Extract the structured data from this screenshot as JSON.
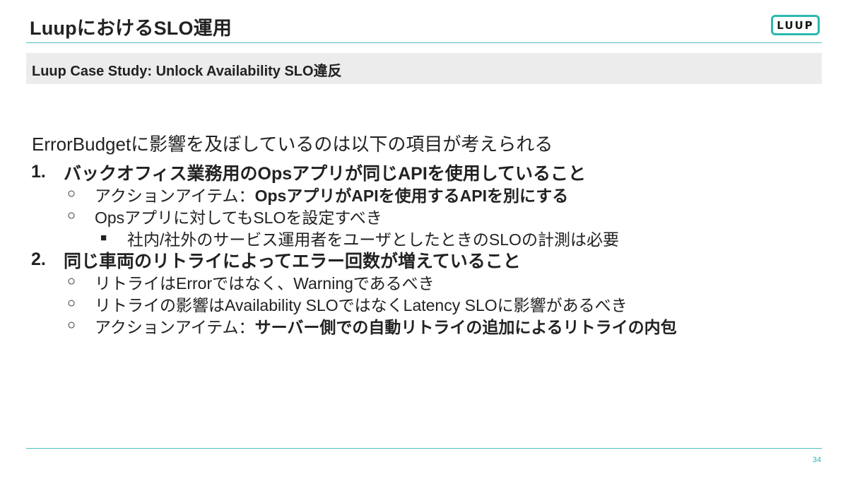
{
  "header": {
    "title": "LuupにおけるSLO運用",
    "logo_text": "LUUP",
    "subtitle": "Luup Case Study: Unlock Availability SLO違反"
  },
  "body": {
    "intro": "ErrorBudgetに影響を及ぼしているのは以下の項目が考えられる",
    "items": [
      {
        "number": "1.",
        "text": "バックオフィス業務用のOpsアプリが同じAPIを使用していること",
        "subitems": [
          {
            "bullet": "○",
            "prefix": "アクションアイテム：",
            "bold": "OpsアプリがAPIを使用するAPIを別にする"
          },
          {
            "bullet": "○",
            "text": "Opsアプリに対してもSLOを設定すべき",
            "subitems": [
              {
                "bullet": "■",
                "text": "社内/社外のサービス運用者をユーザとしたときのSLOの計測は必要"
              }
            ]
          }
        ]
      },
      {
        "number": "2.",
        "text": "同じ車両のリトライによってエラー回数が増えていること",
        "subitems": [
          {
            "bullet": "○",
            "text": "リトライはErrorではなく、Warningであるべき"
          },
          {
            "bullet": "○",
            "text": "リトライの影響はAvailability SLOではなくLatency SLOに影響があるべき"
          },
          {
            "bullet": "○",
            "prefix": "アクションアイテム：",
            "bold": "サーバー側での自動リトライの追加によるリトライの内包"
          }
        ]
      }
    ]
  },
  "footer": {
    "page_number": "34"
  },
  "colors": {
    "accent": "#2bb9b0",
    "subtitle_bg": "#ececec",
    "text": "#222222"
  }
}
